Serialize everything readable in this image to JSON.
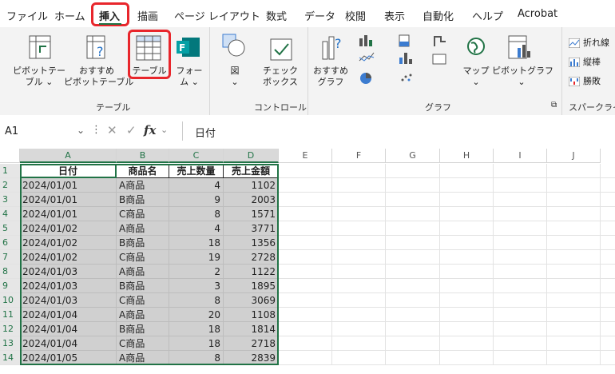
{
  "menu": {
    "items": [
      "ファイル",
      "ホーム",
      "挿入",
      "描画",
      "ページ レイアウト",
      "数式",
      "データ",
      "校閲",
      "表示",
      "自動化",
      "ヘルプ",
      "Acrobat"
    ],
    "active": "挿入"
  },
  "ribbon": {
    "pivot_table": [
      "ピボットテー",
      "ブル ⌄"
    ],
    "recommended_pivot": [
      "おすすめ",
      "ピボットテーブル"
    ],
    "table": "テーブル",
    "forms": [
      "フォー",
      "ム ⌄"
    ],
    "illust": [
      "図",
      "⌄"
    ],
    "checkbox": [
      "チェック",
      "ボックス"
    ],
    "recommended_chart": [
      "おすすめ",
      "グラフ"
    ],
    "map": [
      "マップ",
      "⌄"
    ],
    "pivot_chart": [
      "ピボットグラフ",
      "⌄"
    ],
    "sparklines": [
      "折れ線",
      "縦棒",
      "勝敗"
    ],
    "groups": [
      "テーブル",
      "コントロール",
      "グラフ",
      "スパークライ"
    ]
  },
  "formula_bar": {
    "name_box": "A1",
    "fx": "fx",
    "content": "日付"
  },
  "columns": [
    "A",
    "B",
    "C",
    "D",
    "E",
    "F",
    "G",
    "H",
    "I",
    "J"
  ],
  "table": {
    "headers": [
      "日付",
      "商品名",
      "売上数量",
      "売上金額"
    ],
    "rows": [
      [
        "2024/01/01",
        "A商品",
        "4",
        "1102"
      ],
      [
        "2024/01/01",
        "B商品",
        "9",
        "2003"
      ],
      [
        "2024/01/01",
        "C商品",
        "8",
        "1571"
      ],
      [
        "2024/01/02",
        "A商品",
        "4",
        "3771"
      ],
      [
        "2024/01/02",
        "B商品",
        "18",
        "1356"
      ],
      [
        "2024/01/02",
        "C商品",
        "19",
        "2728"
      ],
      [
        "2024/01/03",
        "A商品",
        "2",
        "1122"
      ],
      [
        "2024/01/03",
        "B商品",
        "3",
        "1895"
      ],
      [
        "2024/01/03",
        "C商品",
        "8",
        "3069"
      ],
      [
        "2024/01/04",
        "A商品",
        "20",
        "1108"
      ],
      [
        "2024/01/04",
        "B商品",
        "18",
        "1814"
      ],
      [
        "2024/01/04",
        "C商品",
        "18",
        "2718"
      ],
      [
        "2024/01/05",
        "A商品",
        "8",
        "2839"
      ]
    ]
  },
  "row_numbers": [
    "1",
    "2",
    "3",
    "4",
    "5",
    "6",
    "7",
    "8",
    "9",
    "10",
    "11",
    "12",
    "13",
    "14"
  ],
  "colors": {
    "highlight": "#e8262c",
    "selection": "#d0d0d0",
    "excel_green": "#217346"
  }
}
